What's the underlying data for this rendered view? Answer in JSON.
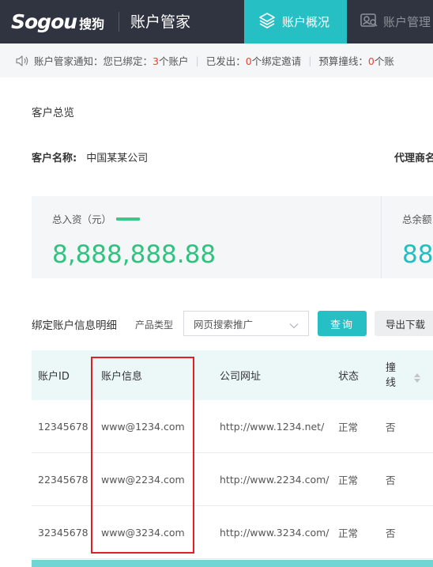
{
  "header": {
    "logo_text": "Sogou",
    "logo_cn": "搜狗",
    "app_title": "账户管家",
    "nav": [
      {
        "label": "账户概况",
        "icon": "layers-icon",
        "active": true
      },
      {
        "label": "账户管理",
        "icon": "account-manage-icon",
        "active": false
      }
    ]
  },
  "notice": {
    "icon": "speaker-icon",
    "items": [
      {
        "prefix": "账户管家通知：您已绑定：",
        "count": "3",
        "suffix": "个账户"
      },
      {
        "prefix": "已发出：",
        "count": "0",
        "suffix": "个绑定邀请"
      },
      {
        "prefix": "预算撞线：",
        "count": "0",
        "suffix": "个账"
      }
    ]
  },
  "overview": {
    "title": "客户总览",
    "customer_label": "客户名称:",
    "customer_value": "中国某某公司",
    "agent_label": "代理商名"
  },
  "stats": [
    {
      "label": "总入资（元）",
      "value": "8,888,888.88",
      "color": "#2fc37f"
    },
    {
      "label": "总余额",
      "value": "88,",
      "color": "#1fbfc3"
    }
  ],
  "filter": {
    "title": "绑定账户信息明细",
    "product_type_label": "产品类型",
    "product_type_value": "网页搜索推广",
    "query_button": "查询",
    "export_button": "导出下载"
  },
  "table": {
    "columns": [
      "账户ID",
      "账户信息",
      "公司网址",
      "状态",
      "撞线"
    ],
    "rows": [
      {
        "id": "12345678",
        "info": "www@1234.com",
        "url": "http://www.1234.net/",
        "status": "正常",
        "hit": "否"
      },
      {
        "id": "22345678",
        "info": "www@2234.com",
        "url": "http://www.2234.com/",
        "status": "正常",
        "hit": "否"
      },
      {
        "id": "32345678",
        "info": "www@3234.com",
        "url": "http://www.3234.com/",
        "status": "正常",
        "hit": "否"
      }
    ]
  },
  "colors": {
    "accent": "#26bfc4",
    "header_bg": "#303440",
    "alert": "#e8413a",
    "success": "#2fc37f",
    "highlight": "#e11f26"
  }
}
